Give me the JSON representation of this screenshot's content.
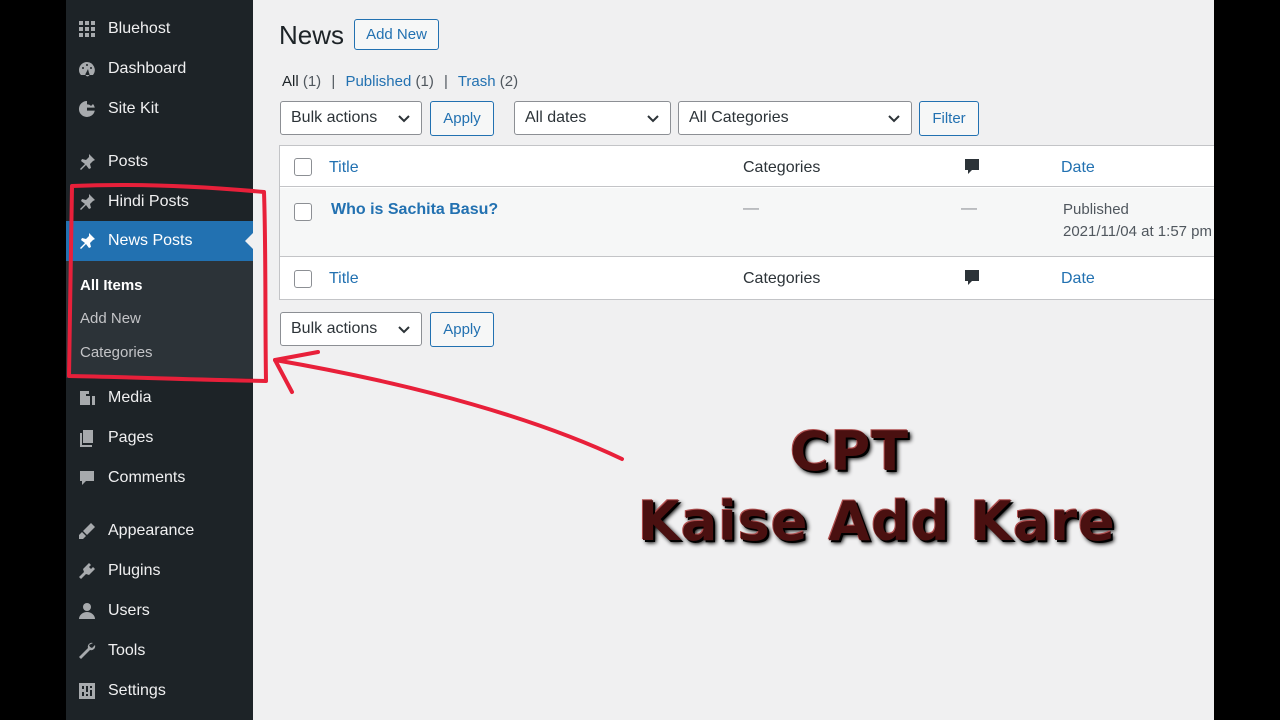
{
  "sidebar": {
    "items": [
      {
        "label": "Bluehost",
        "icon": "grid-icon"
      },
      {
        "label": "Dashboard",
        "icon": "dashboard-icon"
      },
      {
        "label": "Site Kit",
        "icon": "google-icon"
      },
      {
        "label": "Posts",
        "icon": "pin-icon"
      },
      {
        "label": "Hindi Posts",
        "icon": "pin-icon"
      },
      {
        "label": "News Posts",
        "icon": "pin-icon"
      },
      {
        "label": "Media",
        "icon": "media-icon"
      },
      {
        "label": "Pages",
        "icon": "pages-icon"
      },
      {
        "label": "Comments",
        "icon": "comments-icon"
      },
      {
        "label": "Appearance",
        "icon": "appearance-icon"
      },
      {
        "label": "Plugins",
        "icon": "plugins-icon"
      },
      {
        "label": "Users",
        "icon": "users-icon"
      },
      {
        "label": "Tools",
        "icon": "tools-icon"
      },
      {
        "label": "Settings",
        "icon": "settings-icon"
      }
    ],
    "submenu": [
      {
        "label": "All Items"
      },
      {
        "label": "Add New"
      },
      {
        "label": "Categories"
      }
    ]
  },
  "page": {
    "title": "News",
    "add_new": "Add New"
  },
  "status": {
    "all": "All",
    "all_count": "(1)",
    "published": "Published",
    "published_count": "(1)",
    "trash": "Trash",
    "trash_count": "(2)",
    "sep": "|"
  },
  "filters": {
    "bulk_actions": "Bulk actions",
    "apply": "Apply",
    "dates": "All dates",
    "categories": "All Categories",
    "filter": "Filter"
  },
  "table": {
    "headers": {
      "title": "Title",
      "categories": "Categories",
      "date": "Date"
    },
    "rows": [
      {
        "title": "Who is Sachita Basu?",
        "categories": "—",
        "comments": "—",
        "status": "Published",
        "date": "2021/11/04 at 1:57 pm"
      }
    ]
  },
  "annotation": {
    "line1": "CPT",
    "line2": "Kaise Add Kare"
  },
  "colors": {
    "accent": "#2271b1",
    "sidebar": "#1d2327",
    "highlight": "#e8203a"
  }
}
